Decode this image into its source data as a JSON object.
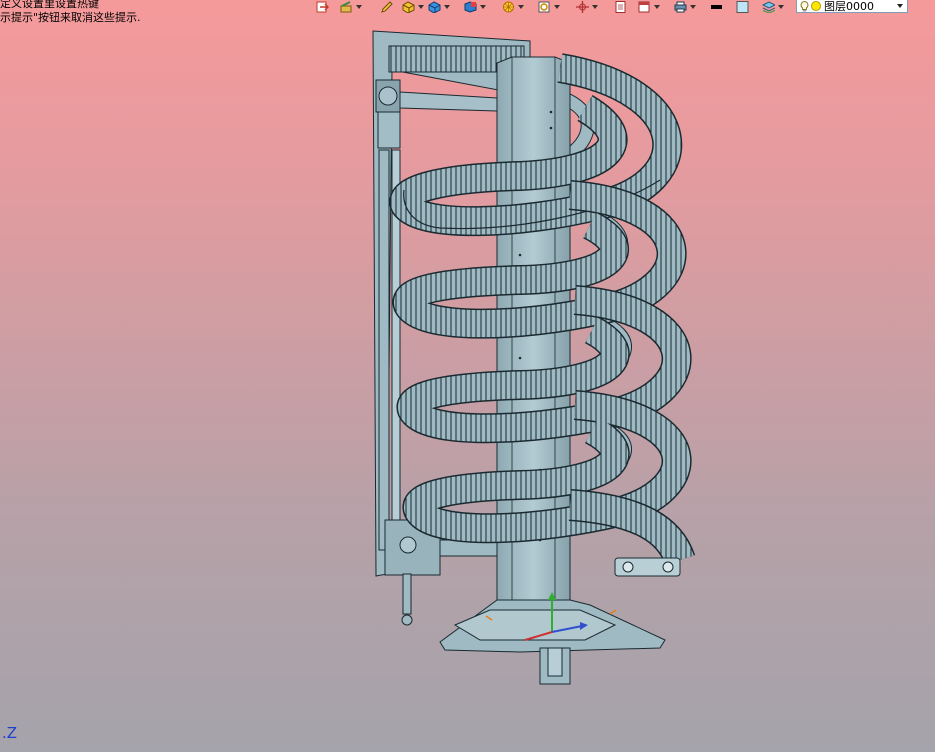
{
  "hints": {
    "line1": "定义设置里设置热键",
    "line2": "示提示\"按钮来取消这些提示."
  },
  "toolbar": {
    "icons": [
      "exit-sketch-icon",
      "sketch-tools-icon",
      "pencil-icon",
      "box-icon",
      "solid-cube-icon",
      "display-style-icon",
      "section-view-icon",
      "zoom-view-icon",
      "move-view-icon",
      "new-doc-icon",
      "window-icon",
      "print-icon",
      "line-color-icon",
      "fill-color-icon",
      "layers-icon"
    ],
    "layer": {
      "name": "图层0000"
    }
  },
  "viewport": {
    "axis_label": "Z",
    "background_top": "#f59a9b",
    "background_bottom": "#a5a3ab",
    "model_color": "#9fbac3",
    "model_edge": "#1a2a30"
  }
}
